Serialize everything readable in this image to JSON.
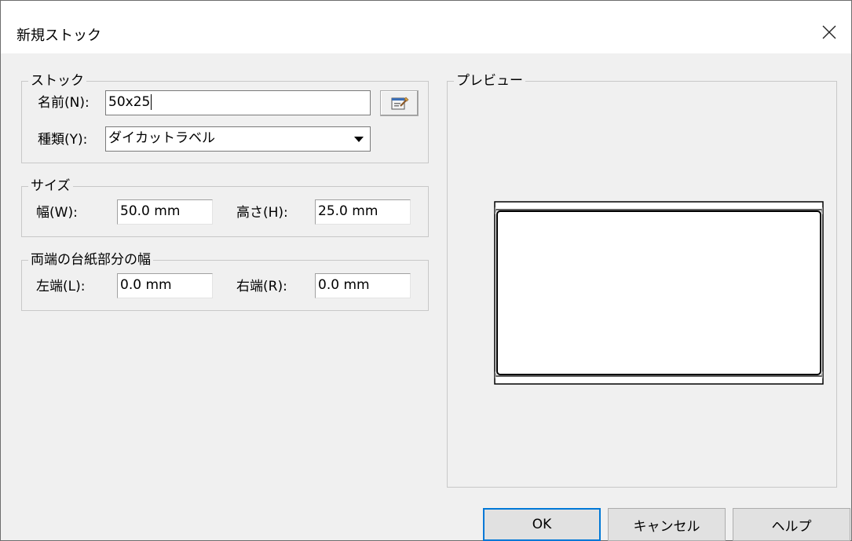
{
  "window": {
    "title": "新規ストック"
  },
  "stock_group": {
    "label": "ストック",
    "name_label": "名前(N):",
    "name_value": "50x25",
    "type_label": "種類(Y):",
    "type_value": "ダイカットラベル"
  },
  "size_group": {
    "label": "サイズ",
    "width_label": "幅(W):",
    "width_value": "50.0 mm",
    "height_label": "高さ(H):",
    "height_value": "25.0 mm"
  },
  "margin_group": {
    "label": "両端の台紙部分の幅",
    "left_label": "左端(L):",
    "left_value": "0.0 mm",
    "right_label": "右端(R):",
    "right_value": "0.0 mm"
  },
  "preview_group": {
    "label": "プレビュー"
  },
  "buttons": {
    "ok": "OK",
    "cancel": "キャンセル",
    "help": "ヘルプ"
  },
  "icons": {
    "close": "close-icon",
    "properties": "properties-icon",
    "dropdown": "chevron-down-icon"
  }
}
